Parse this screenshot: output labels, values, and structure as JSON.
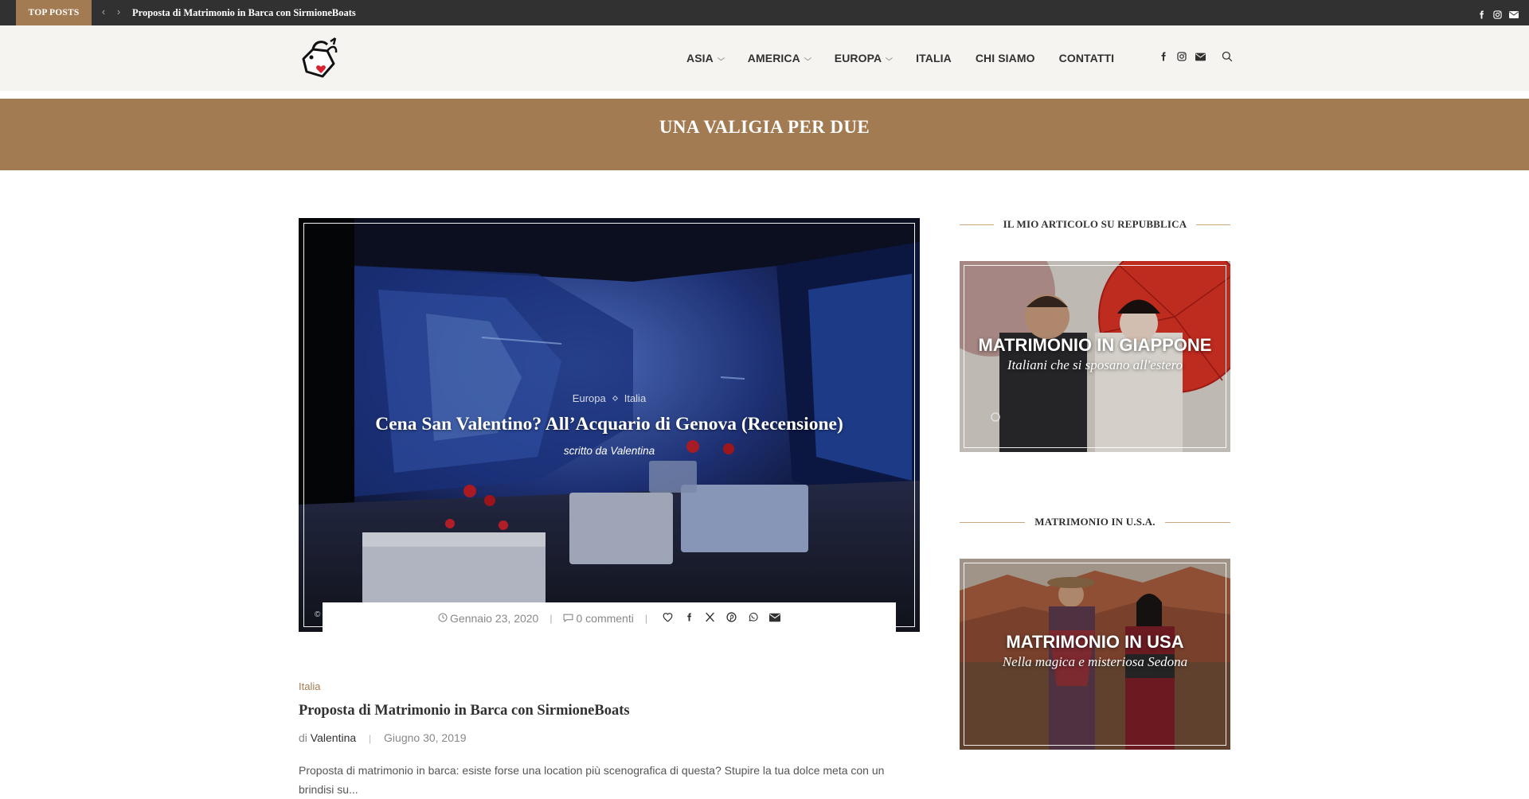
{
  "topbar": {
    "label": "TOP POSTS",
    "current_post": "Proposta di Matrimonio in Barca con SirmioneBoats",
    "social_icons": [
      "facebook-icon",
      "instagram-icon",
      "envelope-icon"
    ]
  },
  "nav": {
    "items": [
      {
        "label": "ASIA",
        "dropdown": true
      },
      {
        "label": "AMERICA",
        "dropdown": true
      },
      {
        "label": "EUROPA",
        "dropdown": true
      },
      {
        "label": "ITALIA",
        "dropdown": false
      },
      {
        "label": "CHI SIAMO",
        "dropdown": false
      },
      {
        "label": "CONTATTI",
        "dropdown": false
      }
    ],
    "icons": [
      "facebook-icon",
      "instagram-icon",
      "envelope-icon",
      "search-icon"
    ]
  },
  "banner": {
    "title": "UNA VALIGIA PER DUE"
  },
  "featured": {
    "categories": [
      "Europa",
      "Italia"
    ],
    "title": "Cena San Valentino? All’Acquario di Genova (Recensione)",
    "author_line": "scritto da Valentina",
    "copyright": "©",
    "date": "Gennaio 23, 2020",
    "comments": "0 commenti",
    "share_icons": [
      "heart-icon",
      "facebook-icon",
      "x-icon",
      "pinterest-icon",
      "whatsapp-icon",
      "envelope-icon"
    ]
  },
  "post": {
    "category": "Italia",
    "title": "Proposta di Matrimonio in Barca con SirmioneBoats",
    "by": "di",
    "author": "Valentina",
    "date": "Giugno 30, 2019",
    "excerpt": "Proposta di matrimonio in barca: esiste forse una location più scenografica di questa? Stupire la tua dolce meta con un brindisi su..."
  },
  "sidebar": {
    "widgets": [
      {
        "heading": "IL MIO ARTICOLO SU REPUBBLICA",
        "caption_title": "MATRIMONIO IN GIAPPONE",
        "caption_sub": "Italiani che si sposano all'estero"
      },
      {
        "heading": "MATRIMONIO IN U.S.A.",
        "caption_title": "MATRIMONIO IN USA",
        "caption_sub": "Nella magica e misteriosa Sedona"
      }
    ]
  },
  "colors": {
    "accent": "#a37b52",
    "topbar": "#313131",
    "header_bg": "#f6f4f1"
  }
}
